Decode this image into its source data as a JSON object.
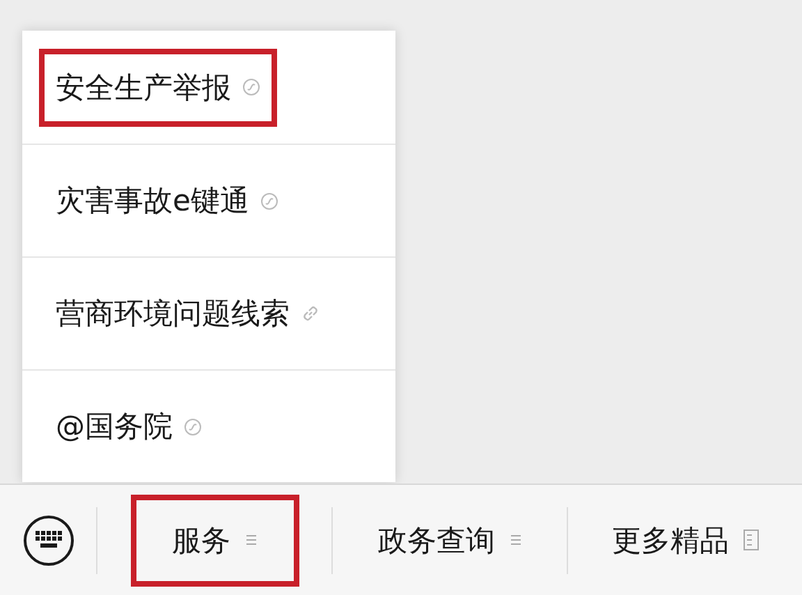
{
  "menu": {
    "items": [
      {
        "label": "安全生产举报",
        "kind": "miniprogram",
        "highlighted": true
      },
      {
        "label": "灾害事故e键通",
        "kind": "miniprogram",
        "highlighted": false
      },
      {
        "label": "营商环境问题线索",
        "kind": "link",
        "highlighted": false
      },
      {
        "label": "@国务院",
        "kind": "miniprogram",
        "highlighted": false
      }
    ]
  },
  "bottom_bar": {
    "tabs": [
      {
        "label": "服务",
        "kind": "submenu",
        "highlighted": true
      },
      {
        "label": "政务查询",
        "kind": "submenu",
        "highlighted": false
      },
      {
        "label": "更多精品",
        "kind": "page",
        "highlighted": false
      }
    ]
  }
}
